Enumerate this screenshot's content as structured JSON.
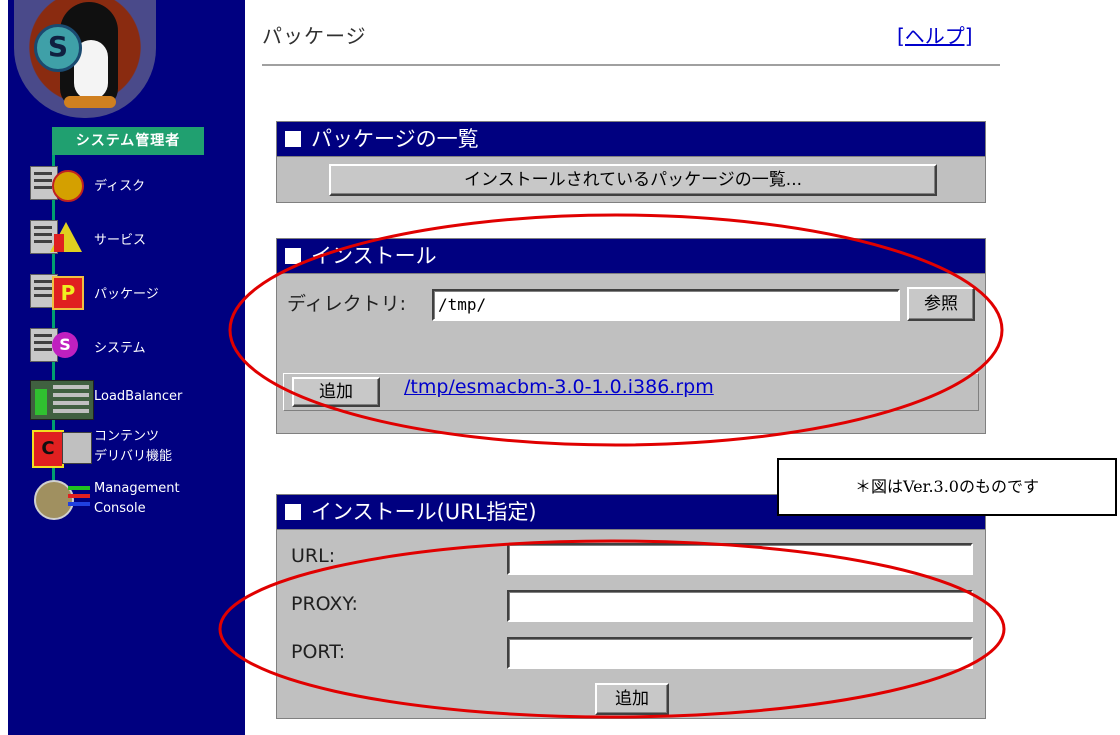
{
  "sidebar": {
    "admin_label": "システム管理者",
    "items": [
      {
        "label": "ディスク"
      },
      {
        "label": "サービス"
      },
      {
        "label": "パッケージ"
      },
      {
        "label": "システム"
      },
      {
        "label": "LoadBalancer"
      },
      {
        "label": "コンテンツ\nデリバリ機能"
      },
      {
        "label": "Management\nConsole"
      }
    ]
  },
  "header": {
    "title": "パッケージ",
    "help_link": "[ヘルプ]"
  },
  "package_list": {
    "heading": "パッケージの一覧",
    "button_label": "インストールされているパッケージの一覧..."
  },
  "install": {
    "heading": "インストール",
    "directory_label": "ディレクトリ:",
    "directory_value": "/tmp/",
    "browse_label": "参照",
    "add_label": "追加",
    "file_link": "/tmp/esmacbm-3.0-1.0.i386.rpm"
  },
  "install_url": {
    "heading": "インストール(URL指定)",
    "url_label": "URL:",
    "proxy_label": "PROXY:",
    "port_label": "PORT:",
    "url_value": "",
    "proxy_value": "",
    "port_value": "",
    "add_label": "追加"
  },
  "note": "＊図はVer.3.0のものです",
  "colors": {
    "sidebar_bg": "#000080",
    "panel_head": "#000080",
    "panel_bg": "#c0c0c0",
    "admin_label_bg": "#20a070",
    "annotation_ovals": "#e00000"
  }
}
